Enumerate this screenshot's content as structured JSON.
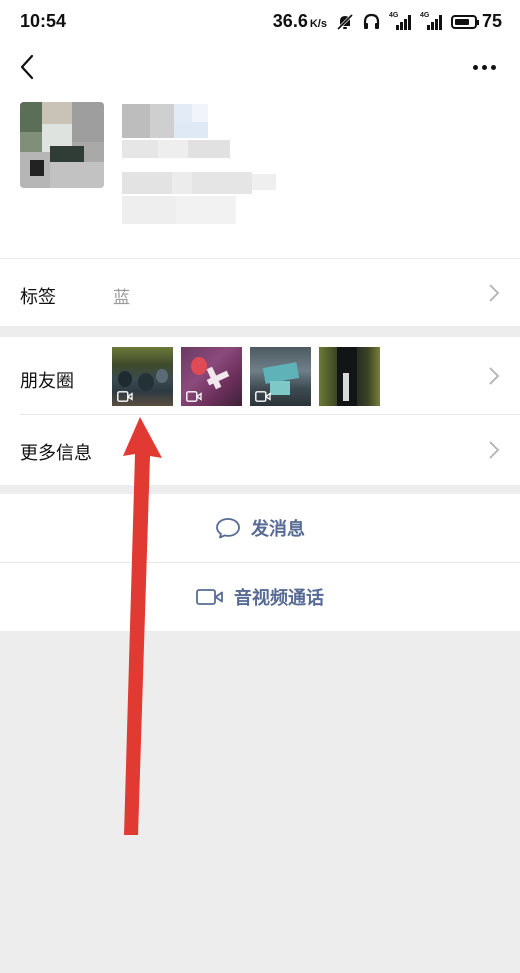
{
  "status_bar": {
    "time": "10:54",
    "net_speed": "36.6",
    "net_unit": "K/s",
    "sim1_tag": "4G",
    "sim2_tag": "4G",
    "battery": "75",
    "icons": [
      "mute-icon",
      "headphones-icon",
      "signal-icon",
      "signal-icon",
      "battery-icon"
    ]
  },
  "nav": {
    "back_icon": "chevron-left-icon",
    "more_icon": "more-dots-icon"
  },
  "profile": {
    "avatar": "blurred-avatar",
    "name": "",
    "details": ""
  },
  "rows": {
    "tags": {
      "label": "标签",
      "value": "蓝"
    },
    "moments": {
      "label": "朋友圈",
      "thumbnail_count": 4
    },
    "more_info": {
      "label": "更多信息"
    }
  },
  "actions": {
    "message": "发消息",
    "call": "音视频通话"
  },
  "colors": {
    "link": "#576b95",
    "arrow": "#e03a32",
    "bg": "#ededed"
  }
}
